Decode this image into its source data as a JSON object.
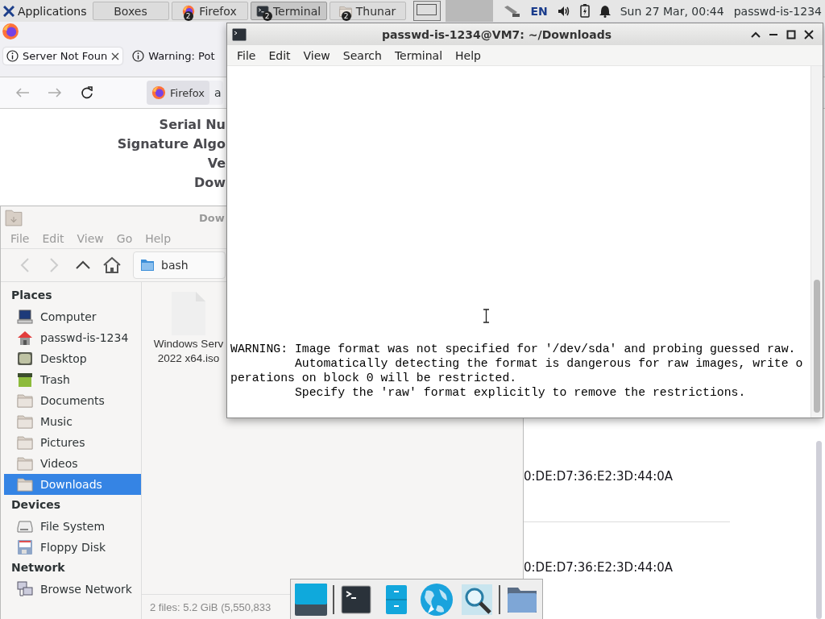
{
  "panel": {
    "app_menu": "Applications",
    "tasks": [
      {
        "label": "Boxes",
        "kind": "plain",
        "selected": false
      },
      {
        "label": "Firefox",
        "kind": "firefox",
        "badge": "2",
        "selected": false
      },
      {
        "label": "Terminal",
        "kind": "terminal",
        "badge": "2",
        "selected": true
      },
      {
        "label": "Thunar",
        "kind": "folder",
        "badge": "2",
        "selected": false
      }
    ],
    "keyboard_layout": "EN",
    "clock": "Sun 27 Mar, 00:44",
    "user": "passwd-is-1234"
  },
  "firefox": {
    "tabs": [
      {
        "label": "Server Not Foun",
        "selected": true
      },
      {
        "label": "Warning: Pot",
        "selected": false
      }
    ],
    "identity": "Firefox",
    "url": "a",
    "cert_labels": [
      "Serial Nu",
      "Signature Algo",
      "Ve",
      "Dow"
    ],
    "cert_values": [
      "0:DE:D7:36:E2:3D:44:0A",
      "0:DE:D7:36:E2:3D:44:0A"
    ]
  },
  "thunar": {
    "title": "Dow",
    "menu": [
      "File",
      "Edit",
      "View",
      "Go",
      "Help"
    ],
    "location": "bash",
    "sidebar": [
      {
        "title": "Places",
        "items": [
          {
            "label": "Computer",
            "kind": "computer",
            "selected": false
          },
          {
            "label": "passwd-is-1234",
            "kind": "home",
            "selected": false
          },
          {
            "label": "Desktop",
            "kind": "desktop",
            "selected": false
          },
          {
            "label": "Trash",
            "kind": "trash",
            "selected": false
          },
          {
            "label": "Documents",
            "kind": "folder",
            "selected": false
          },
          {
            "label": "Music",
            "kind": "folder",
            "selected": false
          },
          {
            "label": "Pictures",
            "kind": "folder",
            "selected": false
          },
          {
            "label": "Videos",
            "kind": "folder",
            "selected": false
          },
          {
            "label": "Downloads",
            "kind": "folder",
            "selected": true
          }
        ]
      },
      {
        "title": "Devices",
        "items": [
          {
            "label": "File System",
            "kind": "drive",
            "selected": false
          },
          {
            "label": "Floppy Disk",
            "kind": "floppy",
            "selected": false
          }
        ]
      },
      {
        "title": "Network",
        "items": [
          {
            "label": "Browse Network",
            "kind": "network",
            "selected": false
          }
        ]
      }
    ],
    "files": [
      {
        "name_lines": [
          "Windows Serv",
          "2022 x64.iso"
        ]
      }
    ],
    "status": "2 files: 5.2 GiB (5,550,833"
  },
  "terminal": {
    "title": "passwd-is-1234@VM7: ~/Downloads",
    "menu": [
      "File",
      "Edit",
      "View",
      "Search",
      "Terminal",
      "Help"
    ],
    "lines": [
      "WARNING: Image format was not specified for '/dev/sda' and probing guessed raw.",
      "         Automatically detecting the format is dangerous for raw images, write o",
      "perations on block 0 will be restricted.",
      "         Specify the 'raw' format explicitly to remove the restrictions."
    ]
  },
  "dock": {
    "groups": [
      {
        "launchers": [
          {
            "kind": "show-desktop"
          }
        ]
      },
      {
        "launchers": [
          {
            "kind": "terminal"
          },
          {
            "kind": "file-cabinet"
          },
          {
            "kind": "globe"
          },
          {
            "kind": "search"
          }
        ]
      },
      {
        "launchers": [
          {
            "kind": "folder"
          }
        ]
      }
    ]
  }
}
